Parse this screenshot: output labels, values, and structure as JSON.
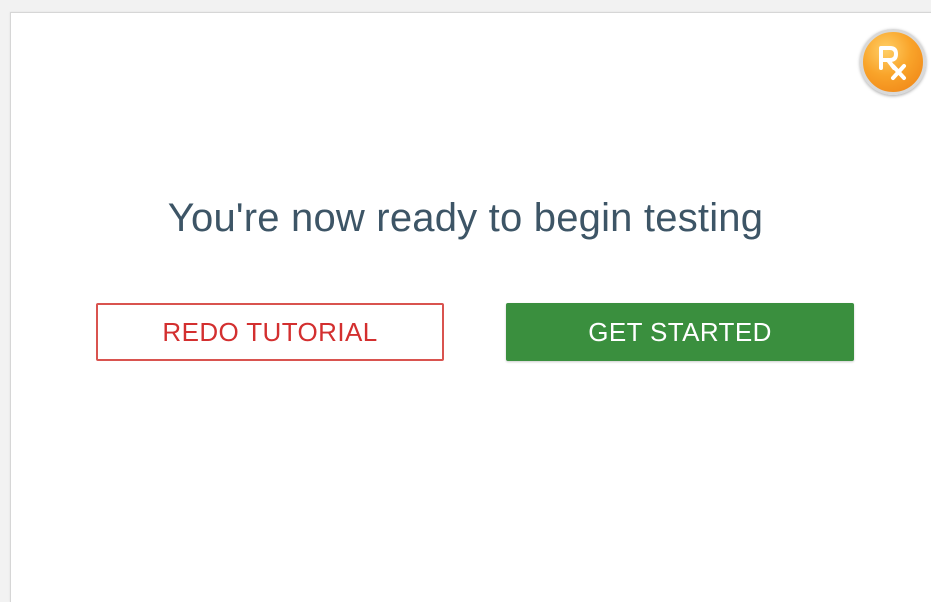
{
  "logo": {
    "icon": "rx-icon",
    "text": "Rx",
    "colors": {
      "fill": "#f9a42a",
      "ring": "#d9d9d9"
    }
  },
  "headline": "You're now ready to begin testing",
  "buttons": {
    "redo_label": "REDO TUTORIAL",
    "start_label": "GET STARTED"
  },
  "colors": {
    "headline": "#3d5566",
    "redo": "#d32f2f",
    "start_bg": "#3a8f3e"
  }
}
